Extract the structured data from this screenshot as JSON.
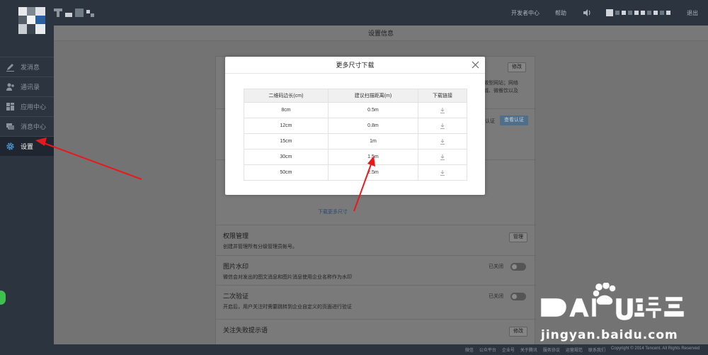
{
  "topbar": {
    "links": [
      "开发者中心",
      "帮助"
    ],
    "logout": "退出"
  },
  "sidebar": {
    "items": [
      {
        "label": "发消息",
        "icon": "pen-icon"
      },
      {
        "label": "通讯录",
        "icon": "contacts-icon"
      },
      {
        "label": "应用中心",
        "icon": "apps-icon"
      },
      {
        "label": "消息中心",
        "icon": "messages-icon"
      },
      {
        "label": "设置",
        "icon": "gear-icon",
        "active": true
      }
    ]
  },
  "page": {
    "title": "设置信息"
  },
  "card": {
    "edit_label": "修改",
    "peek_right_1": "微型网站；网络",
    "peek_right_2": "城、微餐饮以及",
    "peek_verify": "认证",
    "view_verify_label": "查看认证",
    "more_sizes_link": "下载更多尺寸",
    "sections": [
      {
        "title": "权限管理",
        "desc": "创建并管理所有分级管理员帐号。",
        "button": "管理"
      },
      {
        "title": "图片水印",
        "desc": "微信会对发出的图文消息和图片消息使用企业名称作为水印",
        "toggle_label": "已关闭"
      },
      {
        "title": "二次验证",
        "desc": "开启后，用户关注时需要跳转到企业自定义的页面进行验证",
        "toggle_label": "已关闭"
      },
      {
        "title": "关注失败提示语",
        "button": "修改"
      }
    ]
  },
  "modal": {
    "title": "更多尺寸下载",
    "columns": [
      "二维码边长(cm)",
      "建议扫描距离(m)",
      "下载链接"
    ],
    "rows": [
      {
        "size": "8cm",
        "distance": "0.5m"
      },
      {
        "size": "12cm",
        "distance": "0.8m"
      },
      {
        "size": "15cm",
        "distance": "1m"
      },
      {
        "size": "30cm",
        "distance": "1.5m"
      },
      {
        "size": "50cm",
        "distance": "2.5m"
      }
    ]
  },
  "footer": {
    "links": [
      "微信",
      "公众平台",
      "企业号",
      "关于腾讯",
      "服务协议",
      "运营规范",
      "联系我们",
      "Copyright © 2014 Tencent. All Rights Reserved"
    ]
  },
  "watermark": {
    "subtext": "jingyan.baidu.com"
  },
  "colors": {
    "topbar_bg": "#2c3440",
    "accent_arrow": "#e8191b",
    "primary_btn": "#4f6e8a"
  }
}
